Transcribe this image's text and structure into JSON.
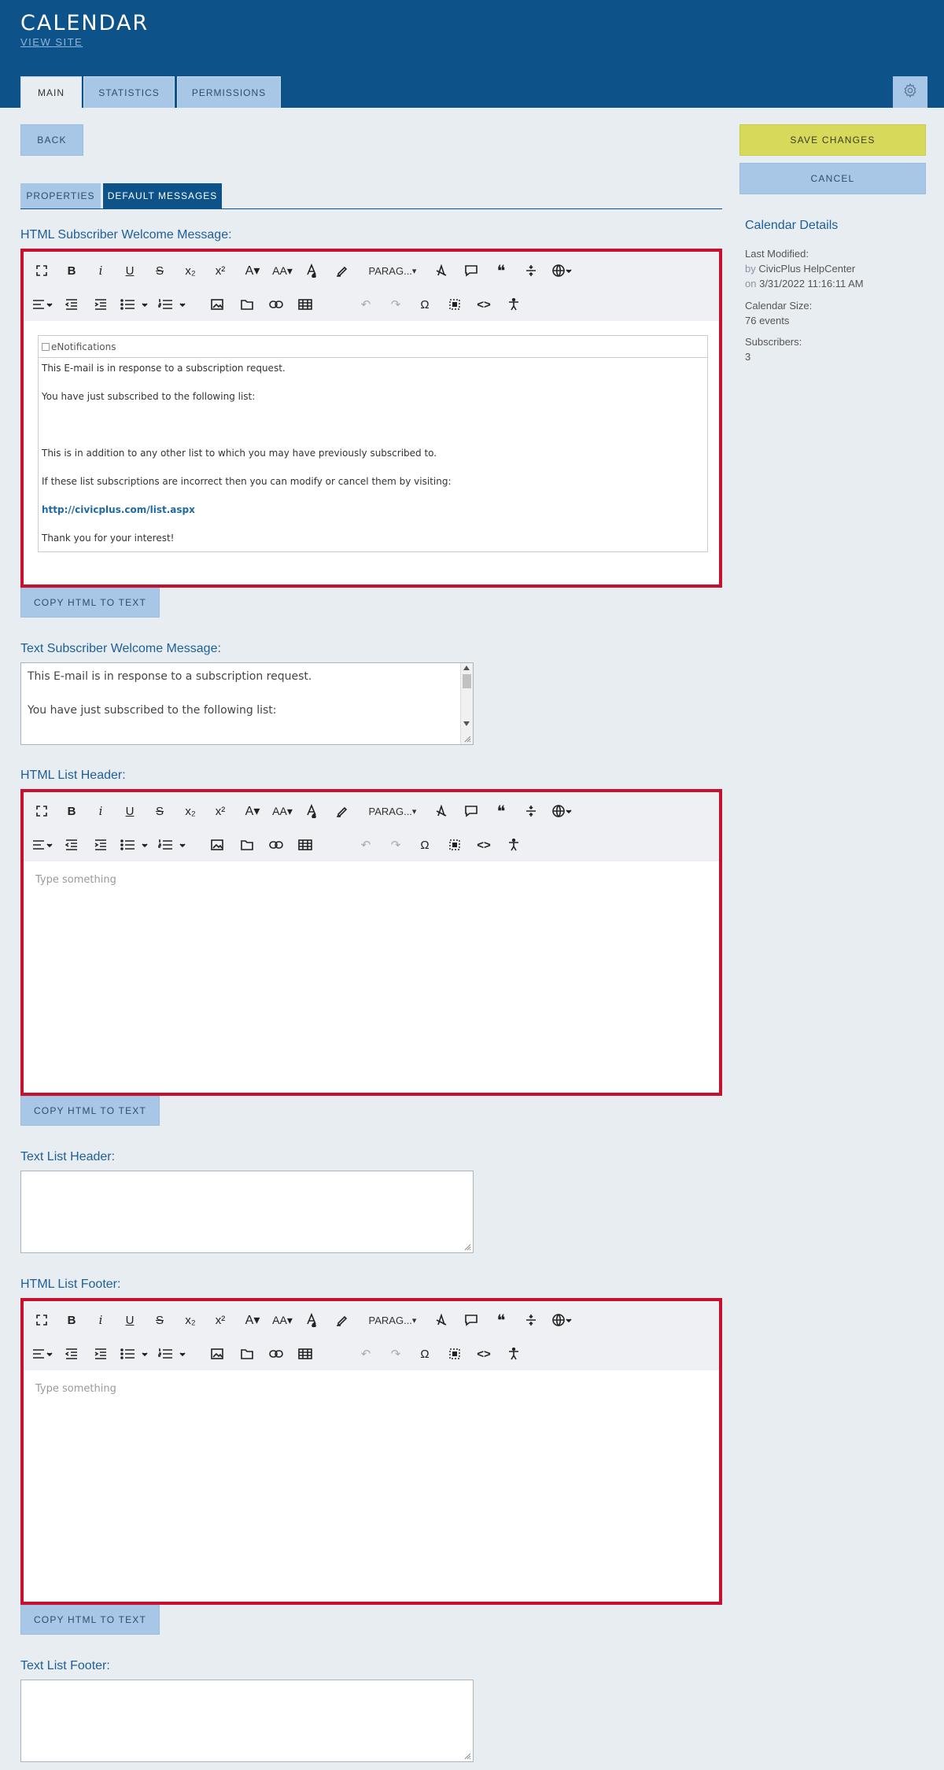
{
  "header": {
    "title": "CALENDAR",
    "view_site": "VIEW SITE",
    "tabs": [
      {
        "label": "MAIN"
      },
      {
        "label": "STATISTICS"
      },
      {
        "label": "PERMISSIONS"
      }
    ],
    "gear_icon": "gear-icon"
  },
  "toolbar_buttons": {
    "back": "BACK",
    "save": "SAVE CHANGES",
    "cancel": "CANCEL"
  },
  "subtabs": [
    {
      "label": "PROPERTIES"
    },
    {
      "label": "DEFAULT MESSAGES"
    }
  ],
  "editor_toolbar": {
    "paragraph_label": "PARAG..."
  },
  "sections": {
    "html_welcome": {
      "label": "HTML Subscriber Welcome Message:",
      "image_alt": "eNotifications",
      "lines": [
        "This E-mail is in response to a subscription request.",
        "You have just subscribed to the following list:",
        "This is in addition to any other list to which you may have previously subscribed to.",
        "If these list subscriptions are incorrect then you can modify or cancel them by visiting:",
        "http://civicplus.com/list.aspx",
        "Thank you for your interest!"
      ],
      "copy_button": "COPY HTML TO TEXT"
    },
    "text_welcome": {
      "label": "Text Subscriber Welcome Message:",
      "lines": [
        "This E-mail is in response to a subscription request.",
        "You have just subscribed to the following list:"
      ]
    },
    "html_header": {
      "label": "HTML List Header:",
      "placeholder": "Type something",
      "copy_button": "COPY HTML TO TEXT"
    },
    "text_header": {
      "label": "Text List Header:"
    },
    "html_footer": {
      "label": "HTML List Footer:",
      "placeholder": "Type something",
      "copy_button": "COPY HTML TO TEXT"
    },
    "text_footer": {
      "label": "Text List Footer:"
    }
  },
  "details": {
    "title": "Calendar Details",
    "last_modified_label": "Last Modified:",
    "by_prefix": "by",
    "by_user": "CivicPlus HelpCenter",
    "on_prefix": "on",
    "on_date": "3/31/2022 11:16:11 AM",
    "size_label": "Calendar Size:",
    "size_value": "76 events",
    "subscribers_label": "Subscribers:",
    "subscribers_value": "3"
  },
  "colors": {
    "header_bg": "#0d5389",
    "tab_bg": "#a8c6e5",
    "save_bg": "#d7d95a",
    "editor_border": "#c8102e",
    "label": "#1d5f97"
  }
}
